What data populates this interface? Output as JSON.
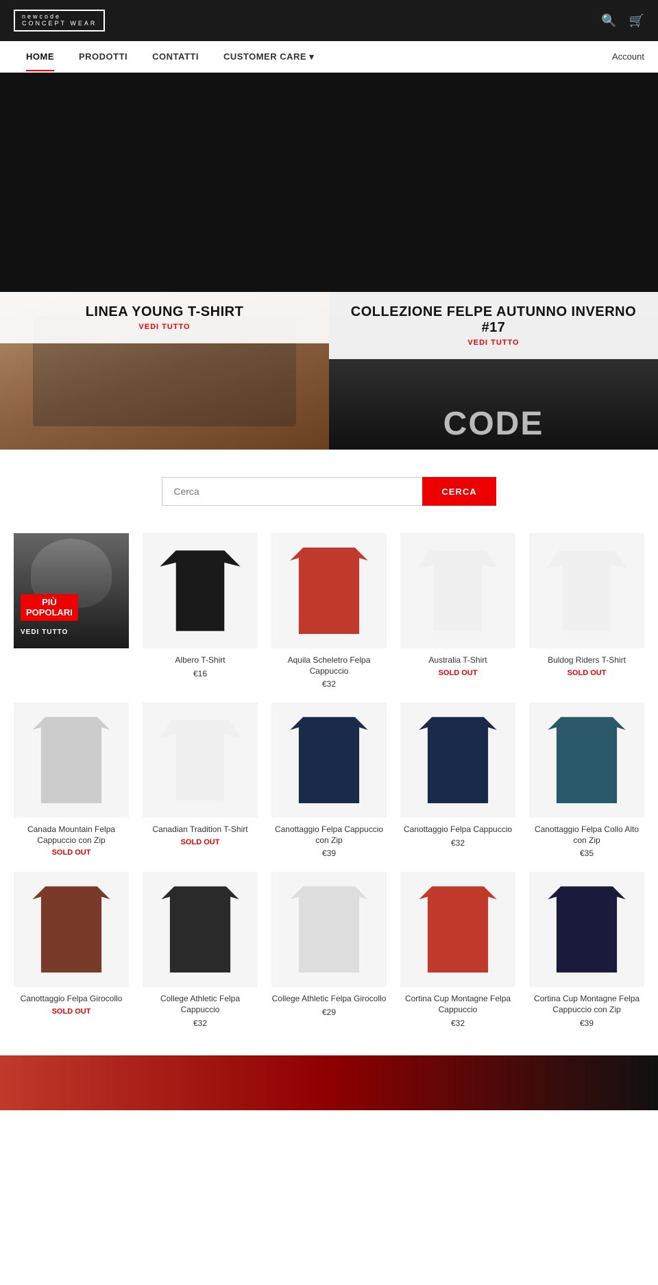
{
  "header": {
    "logo_line1": "newcode",
    "logo_line2": "CONCEPT WEAR",
    "search_icon": "🔍",
    "cart_icon": "🛒"
  },
  "nav": {
    "items": [
      {
        "label": "HOME",
        "active": true
      },
      {
        "label": "PRODOTTI",
        "active": false
      },
      {
        "label": "CONTATTI",
        "active": false
      },
      {
        "label": "CUSTOMER CARE",
        "active": false,
        "has_dropdown": true
      }
    ],
    "account_label": "Account"
  },
  "collections": [
    {
      "title": "LINEA YOUNG T-SHIRT",
      "link_label": "VEDI TUTTO",
      "image_type": "people"
    },
    {
      "title": "COLLEZIONE FELPE AUTUNNO INVERNO #17",
      "link_label": "VEDI TUTTO",
      "image_type": "hoodie_bw"
    }
  ],
  "search": {
    "placeholder": "Cerca",
    "button_label": "CERCA"
  },
  "popular": {
    "label_line1": "PIÙ",
    "label_line2": "POPOLARI",
    "link_label": "VEDI TUTTO"
  },
  "products": [
    {
      "name": "Albero T-Shirt",
      "price": "€16",
      "sold_out": false,
      "image_type": "tshirt-dark"
    },
    {
      "name": "Aquila Scheletro Felpa Cappuccio",
      "price": "€32",
      "sold_out": false,
      "image_type": "hoodie-red2"
    },
    {
      "name": "Australia T-Shirt",
      "price": "",
      "sold_out": true,
      "image_type": "tshirt-white"
    },
    {
      "name": "Buldog Riders T-Shirt",
      "price": "",
      "sold_out": true,
      "image_type": "tshirt-white"
    },
    {
      "name": "Canada Mountain Felpa Cappuccio con Zip",
      "price": "",
      "sold_out": true,
      "image_type": "hoodie-grey"
    },
    {
      "name": "Canadian Tradition T-Shirt",
      "price": "",
      "sold_out": true,
      "image_type": "tshirt-white"
    },
    {
      "name": "Canottaggio Felpa Cappuccio con Zip",
      "price": "€39",
      "sold_out": false,
      "image_type": "hoodie-navy"
    },
    {
      "name": "Canottaggio Felpa Cappuccio",
      "price": "€32",
      "sold_out": false,
      "image_type": "hoodie-navy"
    },
    {
      "name": "Canottaggio Felpa Collo Alto con Zip",
      "price": "€35",
      "sold_out": false,
      "image_type": "hoodie-teal"
    },
    {
      "name": "Canottaggio Felpa Girocollo",
      "price": "",
      "sold_out": true,
      "image_type": "hoodie-brown"
    },
    {
      "name": "College Athletic Felpa Cappuccio",
      "price": "€32",
      "sold_out": false,
      "image_type": "hoodie-charcoal"
    },
    {
      "name": "College Athletic Felpa Girocollo",
      "price": "€29",
      "sold_out": false,
      "image_type": "hoodie-lightgrey"
    },
    {
      "name": "Cortina Cup Montagne Felpa Cappuccio",
      "price": "€32",
      "sold_out": false,
      "image_type": "hoodie-red2"
    },
    {
      "name": "Cortina Cup Montagne Felpa Cappuccio con Zip",
      "price": "€39",
      "sold_out": false,
      "image_type": "hoodie-darknavy"
    }
  ],
  "soldout_label": "SOLD OUT"
}
